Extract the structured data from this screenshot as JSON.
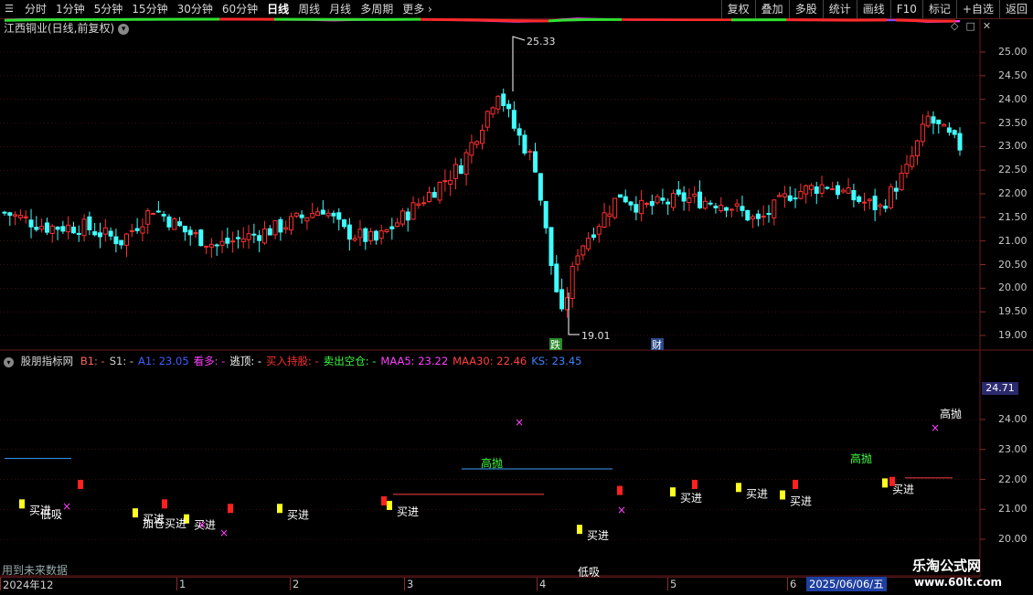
{
  "toolbar": {
    "left": [
      "分时",
      "1分钟",
      "5分钟",
      "15分钟",
      "30分钟",
      "60分钟",
      "日线",
      "周线",
      "月线",
      "多周期",
      "更多"
    ],
    "active": "日线",
    "right": [
      "复权",
      "叠加",
      "多股",
      "统计",
      "画线",
      "F10",
      "标记",
      "+自选",
      "返回"
    ]
  },
  "price_panel": {
    "title": "江西铜业(日线,前复权)",
    "high_label": "25.33",
    "low_label": "19.01",
    "event_fall": "跌",
    "event_finance": "财",
    "y_ticks": [
      "25.00",
      "24.50",
      "24.00",
      "23.50",
      "23.00",
      "22.50",
      "22.00",
      "21.50",
      "21.00",
      "20.50",
      "20.00",
      "19.50",
      "19.00"
    ]
  },
  "indicator_panel": {
    "name": "股朋指标网",
    "fields": [
      {
        "text": "B1: -",
        "color": "#ff6060"
      },
      {
        "text": "S1: -",
        "color": "#d0d0d0"
      },
      {
        "text": "A1: 23.05",
        "color": "#4060ff"
      },
      {
        "text": "看多: -",
        "color": "#ff40ff"
      },
      {
        "text": "逃顶: -",
        "color": "#ffffff"
      },
      {
        "text": "买入持股: -",
        "color": "#ff3030"
      },
      {
        "text": "卖出空仓: -",
        "color": "#40ff40"
      },
      {
        "text": "MAA5: 23.22",
        "color": "#ff40ff"
      },
      {
        "text": "MAA30: 22.46",
        "color": "#ff4040"
      },
      {
        "text": "KS: 23.45",
        "color": "#4080ff"
      }
    ],
    "current_price": "24.71",
    "y_ticks": [
      "24.00",
      "23.00",
      "22.00",
      "21.00",
      "20.00"
    ],
    "signals": {
      "buy": "买进",
      "high_sell": "高抛",
      "low_buy": "低吸",
      "add_buy": "加仓买进"
    }
  },
  "future_note": "用到未来数据",
  "date_axis": {
    "labels": [
      "2024年12",
      "1",
      "2",
      "3",
      "4",
      "5",
      "6"
    ],
    "current_date": "2025/06/06/五"
  },
  "watermark": {
    "site": "乐淘公式网",
    "url": "www.60lt.com"
  },
  "colors": {
    "up": "#ff3030",
    "down": "#40ffff",
    "grid": "#6a1a1a",
    "maa5": "#ff40ff",
    "maa30": "#ff4040",
    "ks": "#3050ff"
  }
}
